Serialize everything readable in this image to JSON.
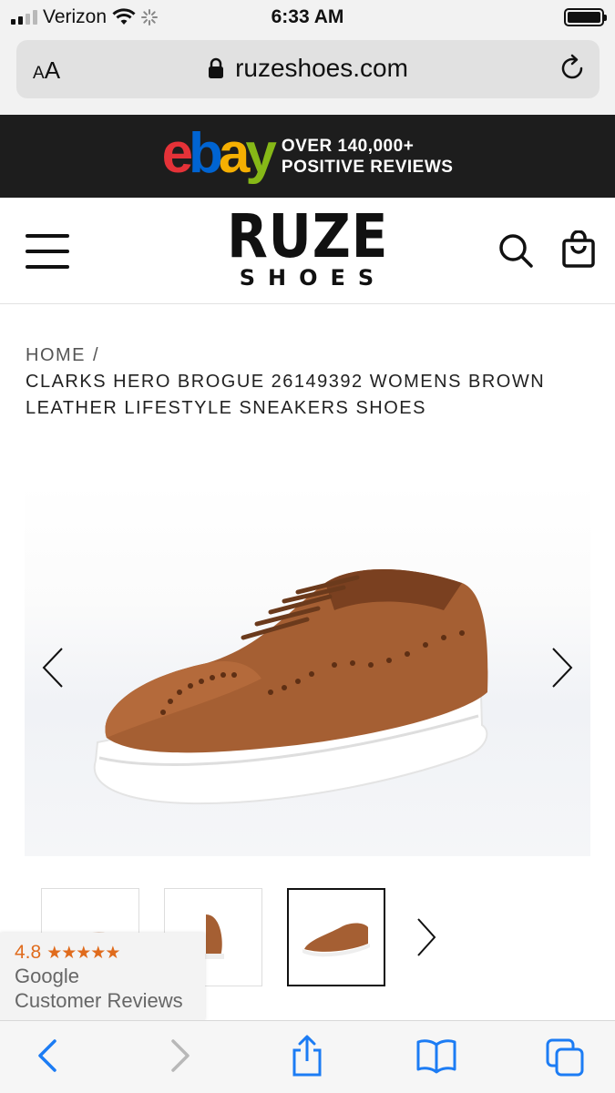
{
  "status_bar": {
    "carrier": "Verizon",
    "time": "6:33 AM"
  },
  "browser": {
    "text_size_label_small": "A",
    "text_size_label_large": "A",
    "url": "ruzeshoes.com"
  },
  "promo_banner": {
    "logo_letters": [
      "e",
      "b",
      "a",
      "y"
    ],
    "line1": "OVER 140,000+",
    "line2": "POSITIVE REVIEWS"
  },
  "header": {
    "logo_main": "RUZE",
    "logo_sub": "SHOES"
  },
  "breadcrumb": {
    "home": "HOME",
    "separator": "/",
    "current": "CLARKS HERO BROGUE 26149392 WOMENS BROWN LEATHER LIFESTYLE SNEAKERS SHOES"
  },
  "gallery": {
    "thumbnail_count": 3,
    "active_thumbnail": 3
  },
  "reviews_badge": {
    "rating": "4.8",
    "stars": "★★★★★",
    "line1": "Google",
    "line2": "Customer Reviews"
  },
  "colors": {
    "promo_bg": "#1d1d1d",
    "ebay_red": "#e53238",
    "ebay_blue": "#0064d2",
    "ebay_yellow": "#f5af02",
    "ebay_green": "#86b817",
    "rating_orange": "#e06b1c",
    "ios_blue": "#1c7cf4",
    "shoe_brown": "#a55f33"
  }
}
